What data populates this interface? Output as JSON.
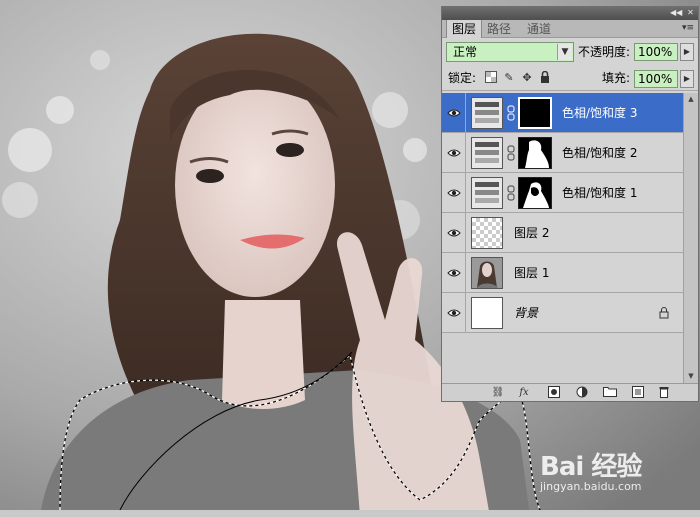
{
  "panel": {
    "tabs": [
      {
        "label": "图层",
        "active": true
      },
      {
        "label": "路径",
        "active": false
      },
      {
        "label": "通道",
        "active": false
      }
    ],
    "blend_mode": "正常",
    "opacity_label": "不透明度:",
    "opacity_value": "100%",
    "lock_label": "锁定:",
    "fill_label": "填充:",
    "fill_value": "100%",
    "layers": [
      {
        "name": "色相/饱和度 3",
        "type": "adjustment",
        "selected": true
      },
      {
        "name": "色相/饱和度 2",
        "type": "adjustment",
        "selected": false
      },
      {
        "name": "色相/饱和度 1",
        "type": "adjustment",
        "selected": false
      },
      {
        "name": "图层 2",
        "type": "transparent",
        "selected": false
      },
      {
        "name": "图层 1",
        "type": "photo",
        "selected": false
      },
      {
        "name": "背景",
        "type": "background",
        "selected": false
      }
    ]
  },
  "watermark": {
    "brand": "Bai 经验",
    "url": "jingyan.baidu.com"
  },
  "colors": {
    "selected_row": "#3a6cc8",
    "field_bg": "#c9f0c0",
    "panel_bg": "#d4d4d4"
  }
}
